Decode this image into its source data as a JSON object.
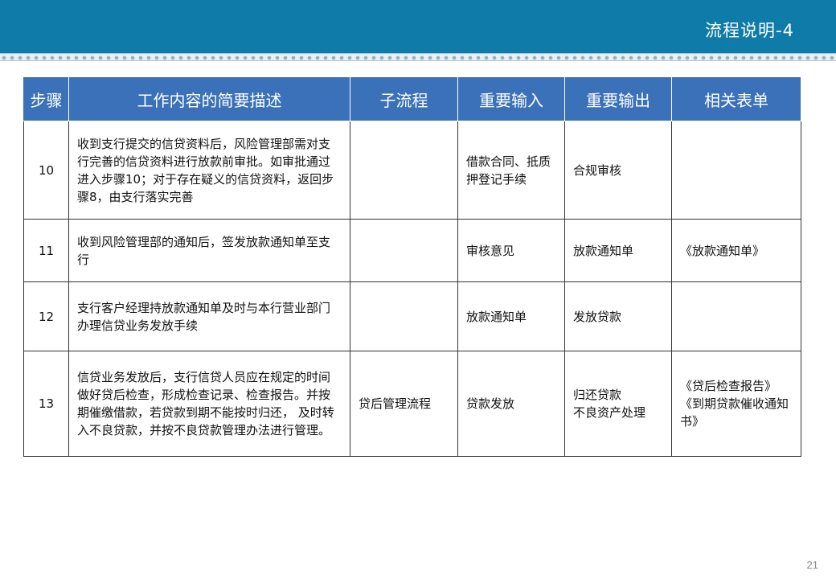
{
  "header": {
    "title": "流程说明-4"
  },
  "table": {
    "columns": [
      "步骤",
      "工作内容的简要描述",
      "子流程",
      "重要输入",
      "重要输出",
      "相关表单"
    ],
    "rows": [
      {
        "step": "10",
        "description": "收到支行提交的信贷资料后，风险管理部需对支行完善的信贷资料进行放款前审批。如审批通过进入步骤10；对于存在疑义的信贷资料，返回步骤8，由支行落实完善",
        "subprocess": "",
        "input": "借款合同、抵质押登记手续",
        "output": "合规审核",
        "forms": ""
      },
      {
        "step": "11",
        "description": "收到风险管理部的通知后，签发放款通知单至支行",
        "subprocess": "",
        "input": "审核意见",
        "output": "放款通知单",
        "forms": "《放款通知单》"
      },
      {
        "step": "12",
        "description": "支行客户经理持放款通知单及时与本行营业部门办理信贷业务发放手续",
        "subprocess": "",
        "input": "放款通知单",
        "output": "发放贷款",
        "forms": ""
      },
      {
        "step": "13",
        "description": "信贷业务发放后，支行信贷人员应在规定的时间做好贷后检查，形成检查记录、检查报告。并按期催缴借款，若贷款到期不能按时归还，  及时转入不良贷款，并按不良贷款管理办法进行管理。",
        "subprocess": "贷后管理流程",
        "input": "贷款发放",
        "output": "归还贷款\n不良资产处理",
        "forms": "《贷后检查报告》\n《到期贷款催收通知书》"
      }
    ]
  },
  "footer": {
    "page_number": "21"
  },
  "colors": {
    "header_bar": "#0f7ba8",
    "table_header": "#3a71b8"
  }
}
